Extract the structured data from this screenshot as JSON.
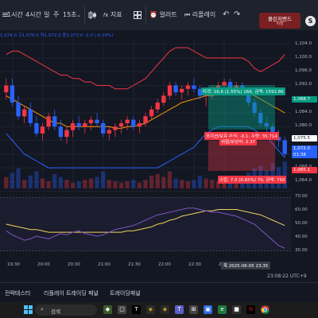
{
  "toolbar": {
    "menu_symbol": "≡",
    "intervals": [
      "1시간",
      "4시간",
      "일",
      "주"
    ],
    "selected_interval": "15초",
    "chevron": "⌄",
    "chart_type_icon": "candles-icon",
    "indicator_label": "지표",
    "layout_icon": "grid-icon",
    "alert_label": "얼러트",
    "replay_label": "리플레이",
    "undo": "↶",
    "redo": "↷",
    "bollinger_label": "볼린저밴드",
    "bollinger_sub": "저장",
    "profile_initial": "S",
    "snapshot_icon": "camera-icon"
  },
  "legend": "1,074.0 고1,076.0 저1,072.0 종1,073.0 -2.0 (-0.19%)",
  "price_axis": {
    "labels": [
      "1,104.0",
      "1,100.0",
      "1,096.0",
      "1,092.0",
      "1,088.0",
      "1,084.0",
      "1,080.0",
      "1,076.0",
      "1,072.0",
      "1,068.0",
      "1,064.0"
    ],
    "current_price_tag": "1,075.5",
    "last_price_tag": "1,072.0",
    "countdown_tag": "01:38",
    "target_tag": "1,088.7",
    "stop_tag": "1,065.1"
  },
  "trade": {
    "profit_text": "타겟: 16.6 (1.55%) 166, 금액: 1592.86",
    "open_pl_text": "포지션/보유 손익: -0.1, 수량: 35.714",
    "ratio_text": "위험/보상비: 2.37",
    "stop_text": "스탑: 7.0 (0.65%) 70, 금액: 750",
    "colors": {
      "profit": "#089981",
      "loss": "#f23645"
    }
  },
  "osc_axis": [
    "70.00",
    "60.00",
    "50.00",
    "40.00",
    "30.00"
  ],
  "time_axis": [
    "19:30",
    "20:00",
    "20:30",
    "21:00",
    "21:30",
    "22:00",
    "22:30",
    "23:00"
  ],
  "date_tag": "목 2025-06-05  23:35",
  "clock": "23:08:22 UTC+9",
  "bottom_tabs": [
    "전략테스터",
    "리플레이 트레이딩 패널",
    "트레이딩패널"
  ],
  "taskbar": {
    "search_placeholder": "검색",
    "icons": [
      "windows-start-icon",
      "search-icon",
      "game-icon",
      "task-view-icon",
      "tradingview-icon",
      "binance-icon",
      "teams-icon",
      "store-icon",
      "photos-icon",
      "edge-icon",
      "netflix-icon",
      "chrome-icon"
    ]
  },
  "colors": {
    "up": "#f23645",
    "down": "#2962ff",
    "upper_band": "#f23645",
    "lower_band": "#2962ff",
    "basis": "#ff9800",
    "rsi": "#7e57c2",
    "rsi_ma": "#f0d35b"
  },
  "chart_data": [
    {
      "type": "candlestick",
      "title": "",
      "ylim": [
        1062,
        1106
      ],
      "candles": [
        [
          1090,
          1094,
          1088,
          1092
        ],
        [
          1092,
          1094,
          1086,
          1087
        ],
        [
          1087,
          1089,
          1082,
          1083
        ],
        [
          1083,
          1086,
          1081,
          1085
        ],
        [
          1085,
          1087,
          1080,
          1081
        ],
        [
          1081,
          1083,
          1077,
          1078
        ],
        [
          1078,
          1081,
          1076,
          1080
        ],
        [
          1080,
          1084,
          1079,
          1083
        ],
        [
          1083,
          1085,
          1079,
          1080
        ],
        [
          1080,
          1082,
          1076,
          1077
        ],
        [
          1077,
          1080,
          1075,
          1079
        ],
        [
          1079,
          1082,
          1077,
          1081
        ],
        [
          1081,
          1083,
          1079,
          1080
        ],
        [
          1080,
          1082,
          1078,
          1081
        ],
        [
          1081,
          1083,
          1079,
          1082
        ],
        [
          1082,
          1084,
          1080,
          1081
        ],
        [
          1081,
          1082,
          1077,
          1078
        ],
        [
          1078,
          1080,
          1076,
          1079
        ],
        [
          1079,
          1081,
          1077,
          1080
        ],
        [
          1080,
          1082,
          1078,
          1081
        ],
        [
          1081,
          1083,
          1079,
          1082
        ],
        [
          1082,
          1083,
          1079,
          1080
        ],
        [
          1080,
          1082,
          1078,
          1081
        ],
        [
          1081,
          1084,
          1080,
          1083
        ],
        [
          1083,
          1086,
          1082,
          1085
        ],
        [
          1085,
          1088,
          1084,
          1087
        ],
        [
          1087,
          1090,
          1086,
          1089
        ],
        [
          1089,
          1093,
          1088,
          1092
        ],
        [
          1092,
          1093,
          1089,
          1090
        ],
        [
          1090,
          1092,
          1088,
          1091
        ],
        [
          1091,
          1093,
          1089,
          1092
        ],
        [
          1092,
          1094,
          1090,
          1091
        ],
        [
          1091,
          1092,
          1088,
          1089
        ],
        [
          1089,
          1091,
          1086,
          1090
        ],
        [
          1090,
          1092,
          1088,
          1091
        ],
        [
          1091,
          1093,
          1089,
          1092
        ],
        [
          1092,
          1094,
          1090,
          1093
        ],
        [
          1093,
          1094,
          1090,
          1091
        ],
        [
          1091,
          1093,
          1089,
          1092
        ],
        [
          1092,
          1093,
          1089,
          1090
        ],
        [
          1090,
          1091,
          1086,
          1087
        ],
        [
          1087,
          1088,
          1083,
          1084
        ],
        [
          1084,
          1085,
          1080,
          1081
        ],
        [
          1081,
          1083,
          1078,
          1080
        ],
        [
          1080,
          1081,
          1076,
          1077
        ],
        [
          1077,
          1079,
          1074,
          1076
        ],
        [
          1076,
          1077,
          1071,
          1072
        ]
      ],
      "upper_band": [
        1101,
        1102,
        1102,
        1101,
        1100,
        1099,
        1098,
        1097,
        1096,
        1095,
        1095,
        1094,
        1094,
        1093,
        1093,
        1092,
        1092,
        1092,
        1091,
        1091,
        1091,
        1092,
        1093,
        1094,
        1096,
        1098,
        1100,
        1102,
        1103,
        1103,
        1103,
        1102,
        1101,
        1100,
        1100,
        1100,
        1100,
        1100,
        1100,
        1100,
        1099,
        1097,
        1096,
        1097,
        1098,
        1099,
        1101
      ],
      "basis": [
        1089,
        1088,
        1087,
        1086,
        1085,
        1084,
        1083,
        1082,
        1081,
        1081,
        1080,
        1080,
        1080,
        1080,
        1080,
        1080,
        1080,
        1080,
        1079.5,
        1079.5,
        1080,
        1080,
        1080.5,
        1081,
        1082,
        1083,
        1084,
        1085,
        1086,
        1087,
        1087.5,
        1088,
        1088.5,
        1089,
        1089,
        1089.5,
        1089.5,
        1090,
        1090,
        1090,
        1089.5,
        1089,
        1088,
        1087,
        1086,
        1085,
        1084
      ],
      "lower_band": [
        1078,
        1076,
        1074,
        1072,
        1071,
        1070,
        1069,
        1068,
        1068,
        1068,
        1068,
        1068,
        1068,
        1068,
        1068,
        1068,
        1068,
        1068,
        1068,
        1068,
        1068,
        1068,
        1068,
        1068,
        1068,
        1068,
        1069,
        1070,
        1071,
        1072,
        1073,
        1074,
        1076,
        1078,
        1079,
        1080,
        1080,
        1080,
        1080,
        1080,
        1080,
        1079,
        1078,
        1077,
        1075,
        1073,
        1071
      ],
      "volume": [
        40,
        55,
        70,
        30,
        45,
        60,
        35,
        25,
        50,
        40,
        30,
        20,
        25,
        30,
        35,
        40,
        60,
        30,
        25,
        20,
        25,
        30,
        20,
        30,
        45,
        50,
        40,
        60,
        35,
        30,
        25,
        30,
        45,
        35,
        30,
        25,
        30,
        40,
        35,
        30,
        55,
        70,
        80,
        65,
        90,
        75,
        95
      ]
    },
    {
      "type": "line",
      "title": "",
      "ylim": [
        25,
        75
      ],
      "series": [
        {
          "values": [
            45,
            42,
            40,
            38,
            39,
            41,
            40,
            39,
            41,
            43,
            42,
            44,
            45,
            43,
            42,
            41,
            42,
            44,
            46,
            47,
            48,
            49,
            51,
            53,
            55,
            57,
            58,
            59,
            60,
            61,
            62,
            62,
            61,
            60,
            59,
            59,
            58,
            57,
            56,
            54,
            52,
            50,
            46,
            42,
            38,
            34,
            32
          ]
        },
        {
          "values": [
            50,
            49,
            48,
            47,
            46,
            46,
            45,
            44,
            44,
            44,
            44,
            44,
            44,
            44,
            44,
            44,
            44,
            44,
            44,
            44,
            45,
            45,
            46,
            47,
            48,
            50,
            51,
            53,
            54,
            56,
            57,
            58,
            59,
            60,
            60,
            61,
            61,
            61,
            61,
            60,
            59,
            58,
            57,
            55,
            53,
            51,
            49
          ]
        }
      ]
    }
  ]
}
